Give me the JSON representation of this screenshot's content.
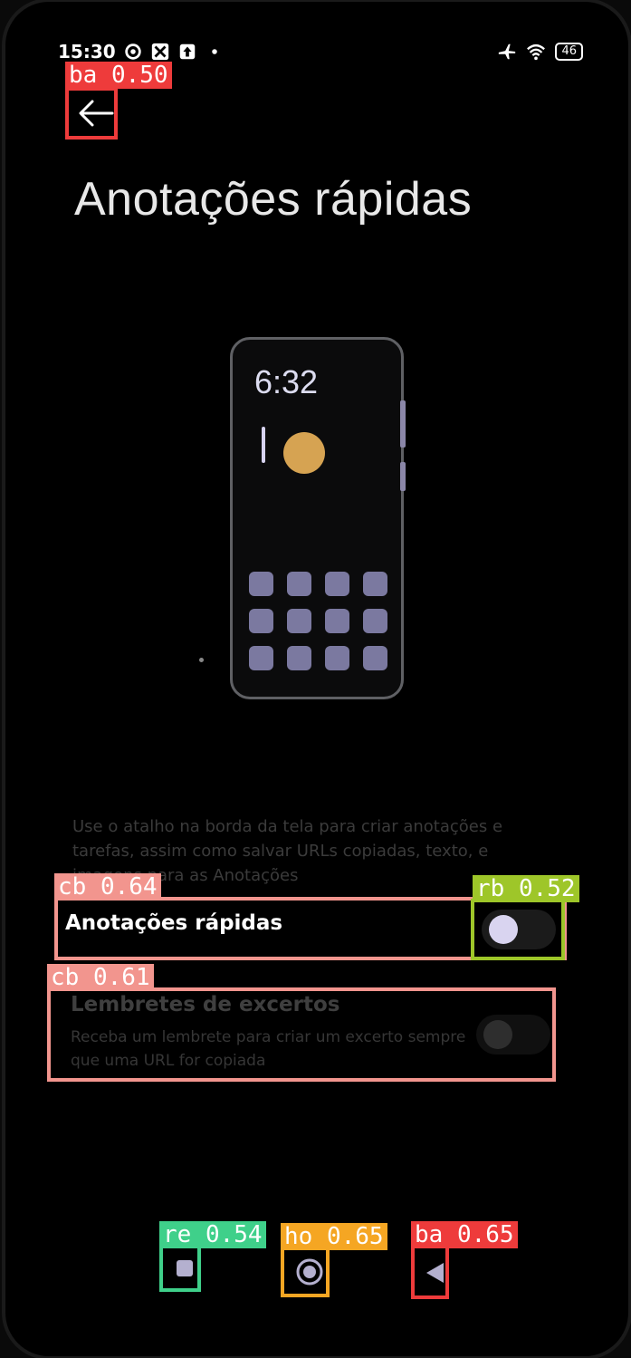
{
  "status_bar": {
    "time": "15:30",
    "battery": "46",
    "icons_left": [
      "gear-icon",
      "vpn-icon",
      "upload-icon",
      "dot-icon"
    ],
    "icons_right": [
      "airplane-icon",
      "wifi-icon",
      "battery-icon"
    ]
  },
  "page": {
    "title": "Anotações rápidas",
    "description": "Use o atalho na borda da tela para criar anotações e tarefas, assim como salvar URLs copiadas, texto, e imagens para as Anotações",
    "illustration_time": "6:32"
  },
  "settings": {
    "quick_notes": {
      "label": "Anotações rápidas",
      "enabled": false
    },
    "excerpt_reminders": {
      "label": "Lembretes de excertos",
      "sublabel": "Receba um lembrete para criar um excerto sempre que uma URL for copiada",
      "enabled": false
    }
  },
  "detections": {
    "back_top": "ba  0.50",
    "quick_notes_row": "cb  0.64",
    "quick_notes_toggle": "rb  0.52",
    "excerpt_row": "cb  0.61",
    "recents": "re  0.54",
    "home": "ho  0.65",
    "back_nav": "ba  0.65"
  },
  "colors": {
    "ba": "#ee3b3b",
    "cb": "#f2958e",
    "rb": "#9ec629",
    "re": "#3fd08a",
    "ho": "#f5a623",
    "accent_knob": "#d9d4f0",
    "illustration_circle": "#d6a352"
  }
}
